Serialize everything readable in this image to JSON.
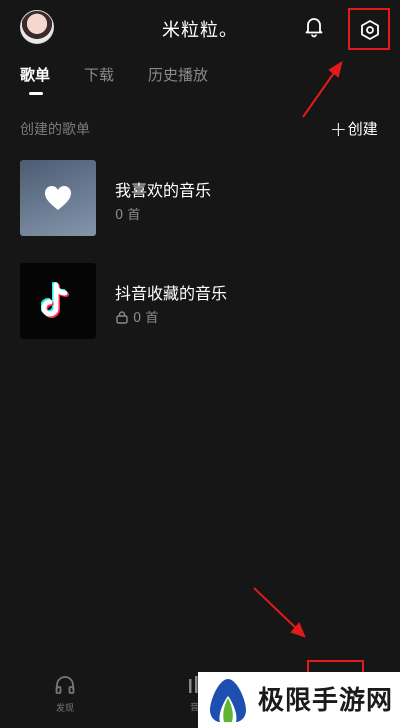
{
  "header": {
    "title": "米粒粒。",
    "avatar_icon": "user-avatar",
    "bell_icon": "bell-icon",
    "settings_icon": "hexagon-gear-icon"
  },
  "tabs": [
    {
      "label": "歌单",
      "active": true
    },
    {
      "label": "下载",
      "active": false
    },
    {
      "label": "历史播放",
      "active": false
    }
  ],
  "section": {
    "title": "创建的歌单",
    "create_label": "创建"
  },
  "playlists": [
    {
      "name": "我喜欢的音乐",
      "count": "0 首",
      "icon": "heart-icon",
      "locked": false
    },
    {
      "name": "抖音收藏的音乐",
      "count": "0 首",
      "icon": "tiktok-icon",
      "locked": true
    }
  ],
  "bottom_nav": {
    "discover_label": "发现",
    "mid_label": "音"
  },
  "watermark": {
    "text": "极限手游网"
  },
  "colors": {
    "background": "#161616",
    "annotation_red": "#e01b1b",
    "muted_text": "#8a8a8a"
  }
}
